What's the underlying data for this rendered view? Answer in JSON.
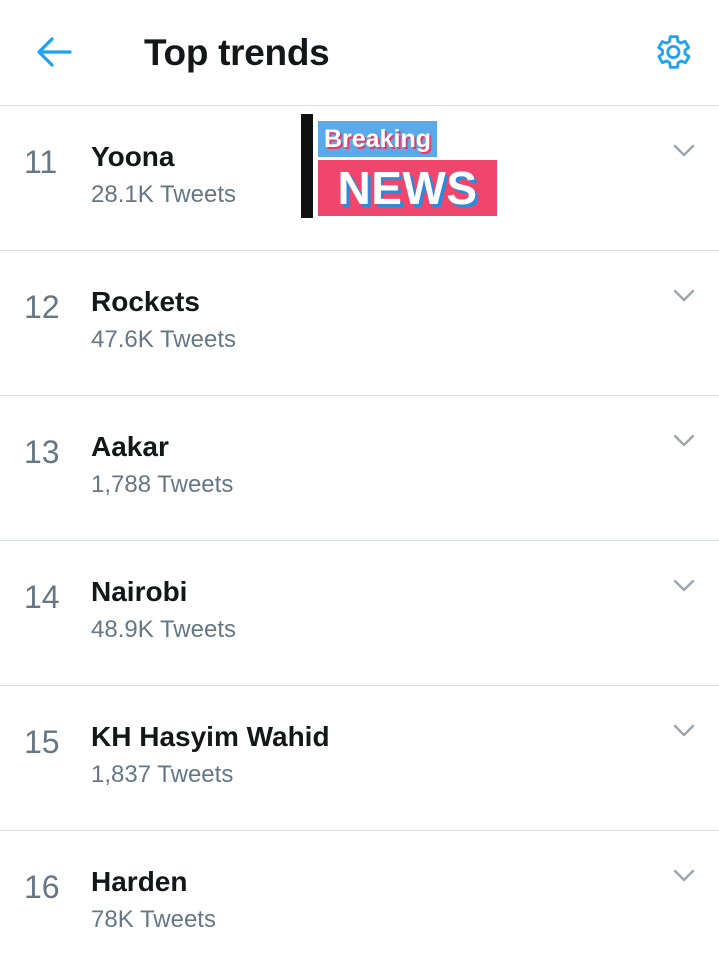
{
  "header": {
    "title": "Top trends",
    "back_icon": "arrow-left-icon",
    "settings_icon": "gear-icon",
    "accent_color": "#1da1f2"
  },
  "overlay": {
    "top_text": "Breaking",
    "bottom_text": "NEWS"
  },
  "trends": [
    {
      "rank": "11",
      "name": "Yoona",
      "tweets": "28.1K Tweets"
    },
    {
      "rank": "12",
      "name": "Rockets",
      "tweets": "47.6K Tweets"
    },
    {
      "rank": "13",
      "name": "Aakar",
      "tweets": "1,788 Tweets"
    },
    {
      "rank": "14",
      "name": "Nairobi",
      "tweets": "48.9K Tweets"
    },
    {
      "rank": "15",
      "name": "KH Hasyim Wahid",
      "tweets": "1,837 Tweets"
    },
    {
      "rank": "16",
      "name": "Harden",
      "tweets": "78K Tweets"
    }
  ]
}
